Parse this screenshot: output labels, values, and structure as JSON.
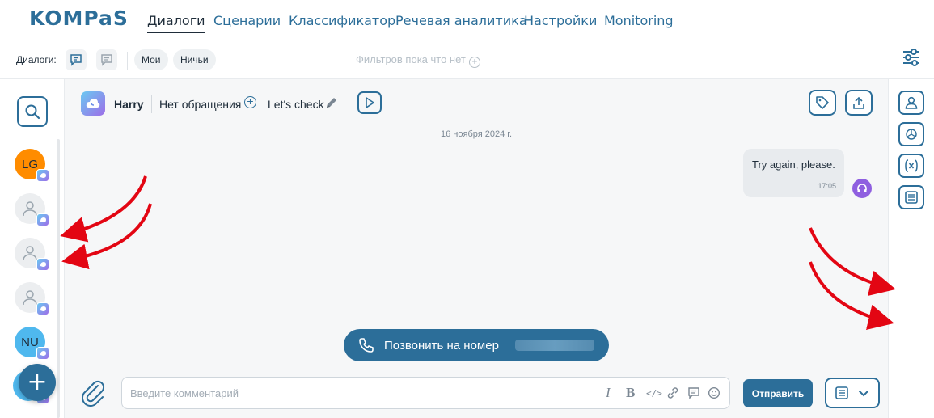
{
  "app": {
    "logo_text": "KOMPaS",
    "nav": [
      "Диалоги",
      "Сценарии",
      "Классификатор",
      "Речевая аналитика",
      "Настройки",
      "Monitoring"
    ],
    "active_nav": "Диалоги"
  },
  "filterbar": {
    "label": "Диалоги:",
    "pills": [
      "Мои",
      "Ничьи"
    ],
    "no_filters": "Фильтров пока что нет"
  },
  "sidebar": {
    "avatars": [
      {
        "initials": "LG",
        "color": "#ff8c00",
        "channel": "phone"
      },
      {
        "initials": "",
        "color": "#eceef0",
        "channel": "phone"
      },
      {
        "initials": "",
        "color": "#eceef0",
        "channel": "phone"
      },
      {
        "initials": "",
        "color": "#eceef0",
        "channel": "phone"
      },
      {
        "initials": "NU",
        "color": "#4fb8ee",
        "channel": "phone"
      }
    ],
    "fab_label": "+"
  },
  "chat": {
    "contact_name": "Harry",
    "appeal": "Нет обращения",
    "subject": "Let's check",
    "date": "16 ноября 2024 г.",
    "messages": [
      {
        "text": "Try again, please.",
        "time": "17:05",
        "from": "operator"
      }
    ],
    "call_button": "Позвонить на номер",
    "composer_placeholder": "Введите комментарий",
    "send_label": "Отправить"
  },
  "colors": {
    "primary": "#2c6e99",
    "annotation_arrow": "#e30613"
  }
}
